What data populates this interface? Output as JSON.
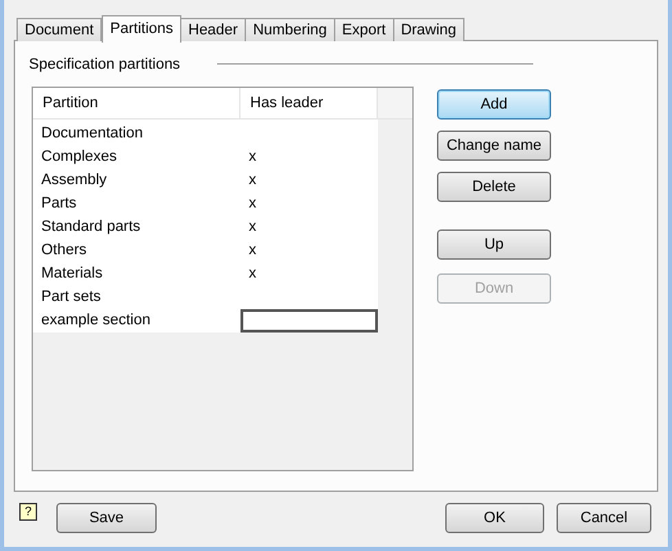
{
  "tabs": [
    {
      "label": "Document",
      "selected": false
    },
    {
      "label": "Partitions",
      "selected": true
    },
    {
      "label": "Header",
      "selected": false
    },
    {
      "label": "Numbering",
      "selected": false
    },
    {
      "label": "Export",
      "selected": false
    },
    {
      "label": "Drawing",
      "selected": false
    }
  ],
  "group_title": "Specification partitions",
  "table": {
    "columns": [
      "Partition",
      "Has leader"
    ],
    "rows": [
      {
        "partition": "Documentation",
        "editing": false
      },
      {
        "partition": "Complexes",
        "has_leader": "x",
        "editing": false
      },
      {
        "partition": "Assembly",
        "has_leader": "x",
        "editing": false
      },
      {
        "partition": "Parts",
        "has_leader": "x",
        "editing": false
      },
      {
        "partition": "Standard parts",
        "has_leader": "x",
        "editing": false
      },
      {
        "partition": "Others",
        "has_leader": "x",
        "editing": false
      },
      {
        "partition": "Materials",
        "has_leader": "x",
        "editing": false
      },
      {
        "partition": "Part sets",
        "editing": false
      },
      {
        "partition": "example section",
        "editing": true
      }
    ]
  },
  "side_buttons": [
    {
      "label": "Add",
      "focused": true,
      "disabled": false
    },
    {
      "label": "Change name",
      "focused": false,
      "disabled": false
    },
    {
      "label": "Delete",
      "focused": false,
      "disabled": false
    },
    {
      "label": "Up",
      "focused": false,
      "disabled": false
    },
    {
      "label": "Down",
      "focused": false,
      "disabled": true
    }
  ],
  "footer": {
    "help": "?",
    "save": "Save",
    "ok": "OK",
    "cancel": "Cancel"
  }
}
